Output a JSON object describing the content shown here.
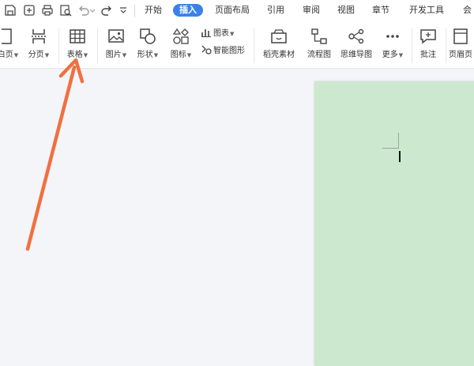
{
  "tabs": [
    {
      "label": "开始"
    },
    {
      "label": "插入"
    },
    {
      "label": "页面布局"
    },
    {
      "label": "引用"
    },
    {
      "label": "审阅"
    },
    {
      "label": "视图"
    },
    {
      "label": "章节"
    },
    {
      "label": "开发工具"
    },
    {
      "label": "会"
    }
  ],
  "ribbon": {
    "page_break_partial": "白页",
    "section_break": "分页",
    "table": "表格",
    "picture": "图片",
    "shape": "形状",
    "icon": "图标",
    "chart": "图表",
    "smart_shape": "智能图形",
    "material": "稻壳素材",
    "flowchart": "流程图",
    "mindmap": "思维导图",
    "more": "更多",
    "comment": "批注",
    "header_footer": "页眉页"
  },
  "colors": {
    "accent": "#3b82e6",
    "page_bg": "#cce8cf",
    "arrow": "#f07040"
  }
}
